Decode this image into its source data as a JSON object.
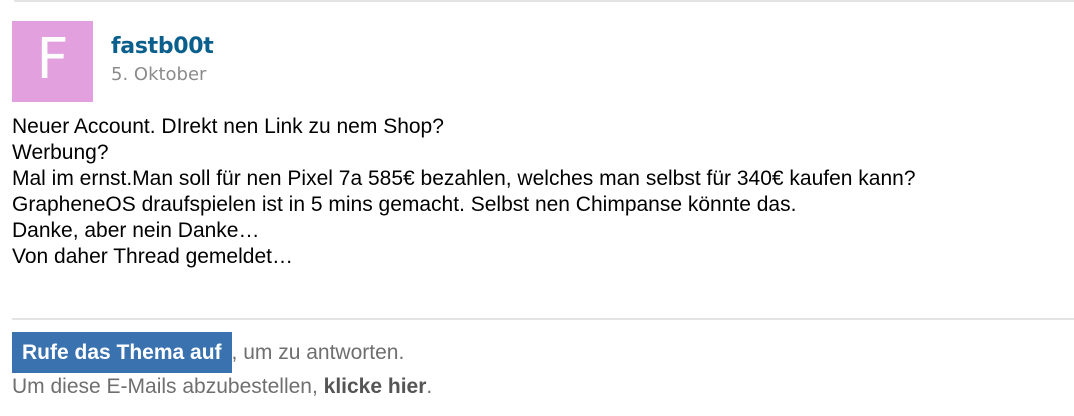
{
  "post": {
    "avatar_letter": "F",
    "author": "fastb00t",
    "date": "5. Oktober",
    "lines": [
      "Neuer Account. DIrekt nen Link zu nem Shop?",
      "Werbung?",
      "Mal im ernst.Man soll für nen Pixel 7a 585€ bezahlen, welches man selbst für 340€ kaufen kann?",
      "GrapheneOS draufspielen ist in 5 mins gemacht. Selbst nen Chimpanse könnte das.",
      "Danke, aber nein Danke…",
      "Von daher Thread gemeldet…"
    ]
  },
  "footer": {
    "reply_button": "Rufe das Thema auf",
    "reply_suffix": ", um zu antworten.",
    "unsubscribe_prefix": "Um diese E-Mails abzubestellen, ",
    "unsubscribe_link": "klicke hier",
    "unsubscribe_suffix": "."
  },
  "colors": {
    "avatar_bg": "#e2a0de",
    "author_link": "#0b5f8c",
    "button_bg": "#3a72b0"
  }
}
